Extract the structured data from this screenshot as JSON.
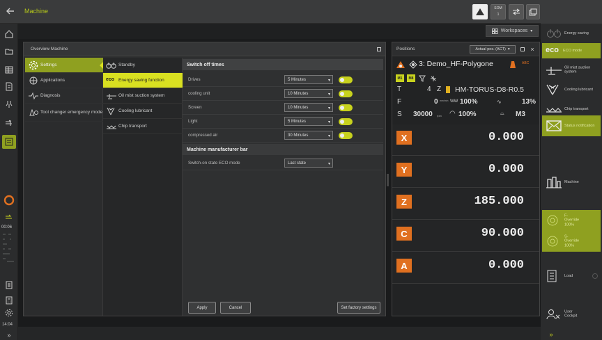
{
  "header": {
    "title": "Machine",
    "som_label": "SOM",
    "som_value": "1",
    "back_icon": "back-arrow-icon"
  },
  "workspace": {
    "label": "Workspaces"
  },
  "left_sidebar": {
    "time": "00:06",
    "clock": "14:04"
  },
  "overview": {
    "title": "Overview Machine",
    "categories": [
      {
        "label": "Settings",
        "icon": "gear-icon"
      },
      {
        "label": "Applications",
        "icon": "applications-icon"
      },
      {
        "label": "Diagnosis",
        "icon": "diagnosis-icon"
      },
      {
        "label": "Tool changer emergency mode",
        "icon": "tool-changer-icon"
      }
    ],
    "settings": [
      {
        "label": "Standby",
        "icon": "standby-icon"
      },
      {
        "label": "Energy saving function",
        "prefix": "eco"
      },
      {
        "label": "Oil mist suction system",
        "icon": "oil-mist-icon"
      },
      {
        "label": "Cooling lubricant",
        "icon": "coolant-icon"
      },
      {
        "label": "Chip transport",
        "icon": "chip-transport-icon"
      }
    ],
    "switch_off_title": "Switch off times",
    "switch_rows": [
      {
        "label": "Drives",
        "value": "5 Minutes",
        "toggle": true
      },
      {
        "label": "cooling unit",
        "value": "10 Minutes",
        "toggle": true
      },
      {
        "label": "Screen",
        "value": "10 Minutes",
        "toggle": true
      },
      {
        "label": "Light",
        "value": "5 Minutes",
        "toggle": true
      },
      {
        "label": "compressed air",
        "value": "30 Minutes",
        "toggle": true
      }
    ],
    "manufacturer_title": "Machine manufacturer bar",
    "eco_row": {
      "label": "Switch-on state ECO mode",
      "value": "Last state"
    },
    "buttons": {
      "apply": "Apply",
      "cancel": "Cancel",
      "factory": "Set factory settings"
    }
  },
  "positions": {
    "title": "Positions",
    "mode": "Actual pos. (ACT)",
    "program": "3: Demo_HF-Polygone",
    "tool_row": {
      "letter": "T",
      "num": "4",
      "axis": "Z",
      "tool": "HM-TORUS-D8-R0.5"
    },
    "feed_row": {
      "letter": "F",
      "value": "0",
      "unit": "mm/min",
      "override": "100%",
      "percent": "13%"
    },
    "spindle_row": {
      "letter": "S",
      "value": "30000",
      "unit": "rpm",
      "override": "100%",
      "m": "M3"
    },
    "axes": [
      {
        "label": "X",
        "value": "0.000"
      },
      {
        "label": "Y",
        "value": "0.000"
      },
      {
        "label": "Z",
        "value": "185.000"
      },
      {
        "label": "C",
        "value": "90.000"
      },
      {
        "label": "A",
        "value": "0.000"
      }
    ]
  },
  "right_panel": {
    "energy_saving": "Energy saving",
    "eco_prefix": "eco",
    "eco_mode": "ECO mode",
    "oil_mist": "Oil mist suction system",
    "cooling": "Cooling lubricant",
    "chip": "Chip transport",
    "status": "Status notification",
    "machine": "Machine",
    "f_override": "F-Override 100%",
    "s_override": "S-Override 100%",
    "load": "Load",
    "user": "User Cockpit"
  },
  "colors": {
    "accent": "#d9e021",
    "orange": "#e07020"
  }
}
